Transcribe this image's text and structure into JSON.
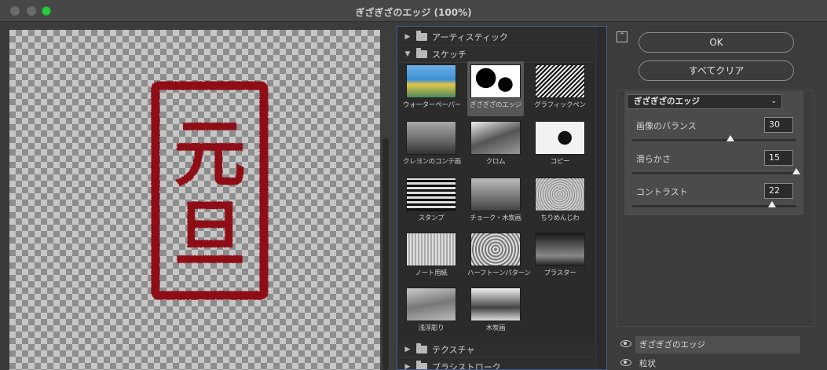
{
  "window": {
    "title": "ぎざぎざのエッジ (100%)"
  },
  "preview": {
    "stamp_text": [
      "元",
      "旦"
    ],
    "stamp_color": "#8e1115"
  },
  "gallery": {
    "categories": [
      {
        "label": "アーティスティック",
        "expanded": false
      },
      {
        "label": "スケッチ",
        "expanded": true
      },
      {
        "label": "テクスチャ",
        "expanded": false
      },
      {
        "label": "ブラシストローク",
        "expanded": false
      }
    ],
    "sketch_filters": [
      "ウォーターペーパー",
      "ぎざぎざのエッジ",
      "グラフィックペン",
      "クレヨンのコンテ画",
      "クロム",
      "コピー",
      "スタンプ",
      "チョーク・木炭画",
      "ちりめんじわ",
      "ノート用紙",
      "ハーフトーンパターン",
      "プラスター",
      "浅浮彫り",
      "木炭画"
    ],
    "selected": "ぎざぎざのエッジ"
  },
  "actions": {
    "ok_label": "OK",
    "clear_all_label": "すべてクリア"
  },
  "settings": {
    "filter_select": "ぎざぎざのエッジ",
    "params": [
      {
        "label": "画像のバランス",
        "value": "30",
        "fraction": 0.6
      },
      {
        "label": "滑らかさ",
        "value": "15",
        "fraction": 1.0
      },
      {
        "label": "コントラスト",
        "value": "22",
        "fraction": 0.85
      }
    ]
  },
  "layers": [
    {
      "name": "ぎざぎざのエッジ",
      "active": true
    },
    {
      "name": "粒状",
      "active": false
    }
  ],
  "colors": {
    "accent_border": "#3f5f8f",
    "maximize_green": "#2ac940"
  }
}
